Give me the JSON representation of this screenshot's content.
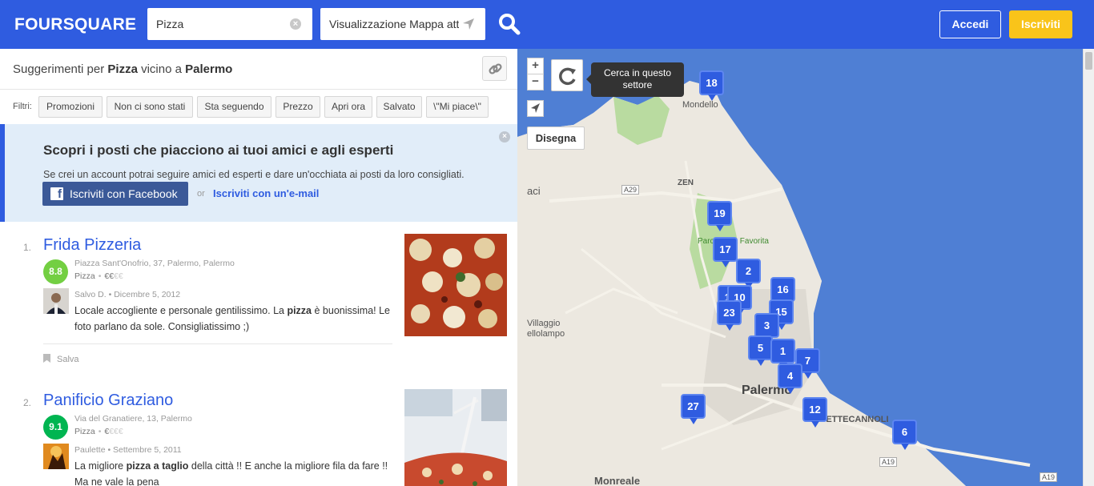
{
  "header": {
    "logo": "FOURSQUARE",
    "search_value": "Pizza",
    "near_value": "Visualizzazione Mappa attu",
    "login_label": "Accedi",
    "signup_label": "Iscriviti"
  },
  "panel": {
    "suggest_prefix": "Suggerimenti per ",
    "suggest_query": "Pizza",
    "suggest_mid": " vicino a ",
    "suggest_place": "Palermo",
    "filters_label": "Filtri:",
    "filters": [
      "Promozioni",
      "Non ci sono stati",
      "Sta seguendo",
      "Prezzo",
      "Apri ora",
      "Salvato",
      "\\\"Mi piace\\\""
    ],
    "promo": {
      "title": "Scopri i posti che piacciono ai tuoi amici e agli esperti",
      "desc": "Se crei un account potrai seguire amici ed esperti e dare un'occhiata ai posti da loro consigliati.",
      "facebook_label": "Iscriviti con Facebook",
      "or": "or",
      "email_label": "Iscriviti con un'e-mail"
    },
    "venues": [
      {
        "num": "1.",
        "name": "Frida Pizzeria",
        "score": "8.8",
        "score_color": "#73cf42",
        "address": "Piazza Sant'Onofrio, 37, Palermo, Palermo",
        "category": "Pizza",
        "price_on": "€€",
        "price_off": "€€",
        "tip_meta": "Salvo D. • Dicembre 5, 2012",
        "tip_parts": [
          "Locale accogliente e personale gentilissimo. La ",
          "pizza",
          " è buonissima! Le foto parlano da sole. Consigliatissimo ;)"
        ],
        "save_label": "Salva"
      },
      {
        "num": "2.",
        "name": "Panificio Graziano",
        "score": "9.1",
        "score_color": "#00b551",
        "address": "Via del Granatiere, 13, Palermo",
        "category": "Pizza",
        "price_on": "€",
        "price_off": "€€€",
        "tip_meta": "Paulette • Settembre 5, 2011",
        "tip_parts": [
          "La migliore ",
          "pizza a taglio",
          " della città !! E anche la migliore fila da fare !! Ma ne vale la pena"
        ]
      }
    ]
  },
  "map": {
    "zoom_in": "+",
    "zoom_out": "−",
    "tooltip": "Cerca in questo settore",
    "draw_label": "Disegna",
    "labels": {
      "mondello": "Mondello",
      "zen": "ZEN",
      "a29": "A29",
      "parco": "Parco della Favorita",
      "villaggio": "Villaggio",
      "bellolampo": "ellolampo",
      "aci": "aci",
      "palermo": "Palermo",
      "settecannoli": "SETTECANNOLI",
      "a19": "A19",
      "a19b": "A19",
      "monreale": "Monreale"
    },
    "pins": [
      "18",
      "19",
      "17",
      "2",
      "11",
      "10",
      "16",
      "23",
      "15",
      "3",
      "5",
      "1",
      "7",
      "4",
      "27",
      "12",
      "6"
    ]
  }
}
